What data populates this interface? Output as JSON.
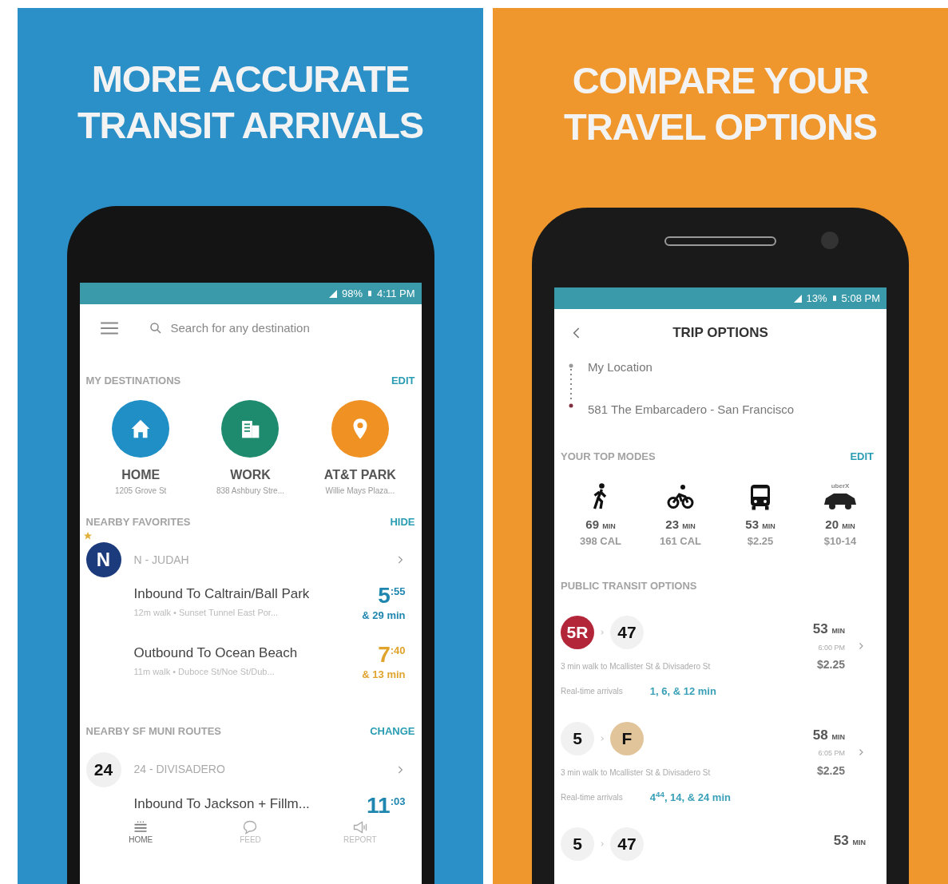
{
  "left_panel": {
    "headline": [
      "MORE ACCURATE",
      "TRANSIT ARRIVALS"
    ],
    "status_bar": {
      "battery": "98%",
      "time": "4:11 PM"
    },
    "search": {
      "placeholder": "Search for any destination"
    },
    "destinations": {
      "title": "MY DESTINATIONS",
      "action": "EDIT",
      "items": [
        {
          "kind": "home",
          "name": "HOME",
          "address": "1205 Grove St",
          "color": "#1f8fc6"
        },
        {
          "kind": "work",
          "name": "WORK",
          "address": "838 Ashbury Stre...",
          "color": "#1e8a6e"
        },
        {
          "kind": "place",
          "name": "AT&T PARK",
          "address": "Willie Mays Plaza...",
          "color": "#ef9223"
        }
      ]
    },
    "favorites": {
      "title": "NEARBY FAVORITES",
      "action": "HIDE",
      "route": {
        "badge": "N",
        "name": "N - JUDAH",
        "favorite": true
      },
      "trips": [
        {
          "direction": "Inbound To Caltrain/Ball Park",
          "detail": "12m walk • Sunset Tunnel East Por...",
          "minutes": "5",
          "seconds": ":55",
          "next": "& 29 min",
          "color": "#1f86b0"
        },
        {
          "direction": "Outbound To Ocean Beach",
          "detail": "11m walk • Duboce St/Noe St/Dub...",
          "minutes": "7",
          "seconds": ":40",
          "next": "& 13 min",
          "color": "#e0a32c"
        }
      ]
    },
    "routes": {
      "title": "NEARBY SF MUNI ROUTES",
      "action": "CHANGE",
      "route": {
        "badge": "24",
        "name": "24 - DIVISADERO",
        "favorite": false
      },
      "trips": [
        {
          "direction": "Inbound To Jackson + Fillm...",
          "minutes": "11",
          "seconds": ":03",
          "color": "#1f86b0"
        }
      ]
    },
    "nav": [
      {
        "kind": "home",
        "label": "HOME",
        "selected": true
      },
      {
        "kind": "feed",
        "label": "FEED",
        "selected": false
      },
      {
        "kind": "report",
        "label": "REPORT",
        "selected": false
      }
    ]
  },
  "right_panel": {
    "headline": [
      "COMPARE YOUR",
      "TRAVEL OPTIONS"
    ],
    "status_bar": {
      "battery": "13%",
      "time": "5:08 PM"
    },
    "title": "TRIP OPTIONS",
    "origin": "My Location",
    "destination": "581 The Embarcadero - San Francisco",
    "modes": {
      "title": "YOUR TOP MODES",
      "action": "EDIT",
      "items": [
        {
          "kind": "walk",
          "time": "69",
          "unit": "MIN",
          "detail": "398 CAL"
        },
        {
          "kind": "bike",
          "time": "23",
          "unit": "MIN",
          "detail": "161 CAL"
        },
        {
          "kind": "bus",
          "time": "53",
          "unit": "MIN",
          "detail": "$2.25"
        },
        {
          "kind": "car",
          "brand": "uberX",
          "time": "20",
          "unit": "MIN",
          "detail": "$10-14"
        }
      ]
    },
    "transit": {
      "title": "PUBLIC TRANSIT OPTIONS",
      "options": [
        {
          "lines": [
            {
              "label": "5R",
              "color": "#b3263a"
            },
            {
              "label": "47",
              "color": "#f1f1f1"
            }
          ],
          "duration": "53",
          "unit": "MIN",
          "depart": "6:00 PM",
          "fare": "$2.25",
          "walk": "3 min walk to Mcallister St & Divisadero St",
          "realtime_label": "Real-time arrivals",
          "arrivals": "1, 6, & 12 min"
        },
        {
          "lines": [
            {
              "label": "5",
              "color": "#f1f1f1"
            },
            {
              "label": "F",
              "color": "#e2c49a"
            }
          ],
          "duration": "58",
          "unit": "MIN",
          "depart": "6:05 PM",
          "fare": "$2.25",
          "walk": "3 min walk to Mcallister St & Divisadero St",
          "realtime_label": "Real-time arrivals",
          "arrivals": "4$^{44}$, 14, & 24 min"
        },
        {
          "lines": [
            {
              "label": "5",
              "color": "#f1f1f1"
            },
            {
              "label": "47",
              "color": "#f1f1f1"
            }
          ],
          "duration": "53",
          "unit": "MIN"
        }
      ]
    }
  }
}
